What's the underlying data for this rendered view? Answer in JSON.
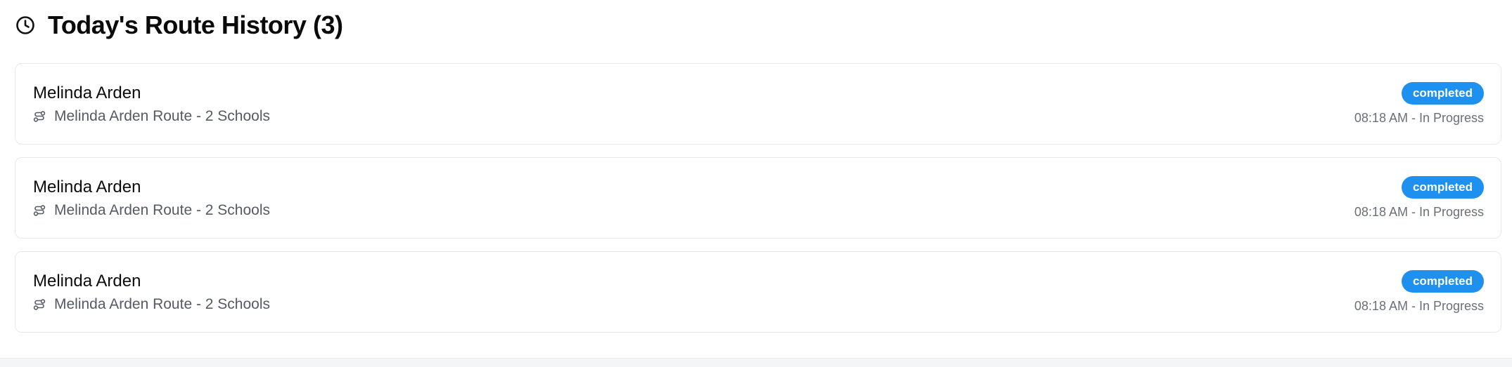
{
  "header": {
    "title": "Today's Route History (3)",
    "icon": "clock-icon"
  },
  "routes": [
    {
      "name": "Melinda Arden",
      "route": "Melinda Arden Route - 2 Schools",
      "status": "completed",
      "time": "08:18 AM - In Progress"
    },
    {
      "name": "Melinda Arden",
      "route": "Melinda Arden Route - 2 Schools",
      "status": "completed",
      "time": "08:18 AM - In Progress"
    },
    {
      "name": "Melinda Arden",
      "route": "Melinda Arden Route - 2 Schools",
      "status": "completed",
      "time": "08:18 AM - In Progress"
    }
  ],
  "colors": {
    "badge": "#1e90f0",
    "border": "#e6e8eb"
  }
}
